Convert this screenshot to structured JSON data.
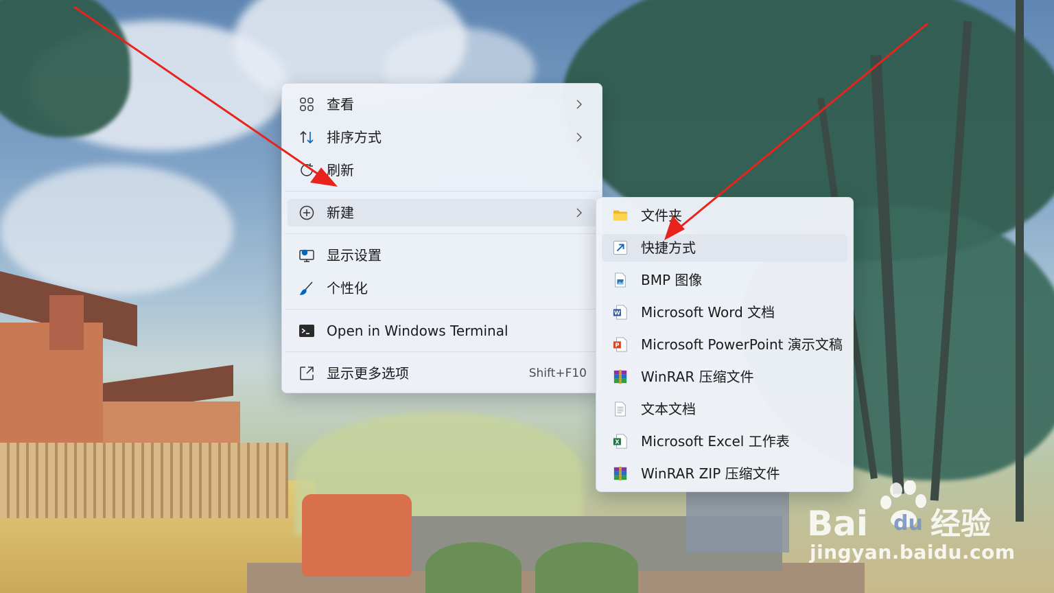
{
  "context_menu": {
    "items": [
      {
        "id": "view",
        "label": "查看",
        "icon": "grid-icon",
        "has_submenu": true
      },
      {
        "id": "sort",
        "label": "排序方式",
        "icon": "sort-icon",
        "has_submenu": true
      },
      {
        "id": "refresh",
        "label": "刷新",
        "icon": "refresh-icon",
        "has_submenu": false
      },
      {
        "id": "new",
        "label": "新建",
        "icon": "plus-circle-icon",
        "has_submenu": true,
        "highlighted": true
      },
      {
        "id": "display",
        "label": "显示设置",
        "icon": "display-settings-icon",
        "has_submenu": false
      },
      {
        "id": "personalize",
        "label": "个性化",
        "icon": "brush-icon",
        "has_submenu": false
      },
      {
        "id": "terminal",
        "label": "Open in Windows Terminal",
        "icon": "terminal-icon",
        "has_submenu": false
      },
      {
        "id": "more",
        "label": "显示更多选项",
        "icon": "more-options-icon",
        "shortcut": "Shift+F10"
      }
    ]
  },
  "submenu_new": {
    "items": [
      {
        "label": "文件夹",
        "icon": "folder-icon"
      },
      {
        "label": "快捷方式",
        "icon": "shortcut-icon",
        "highlighted": true
      },
      {
        "label": "BMP 图像",
        "icon": "bmp-image-icon"
      },
      {
        "label": "Microsoft Word 文档",
        "icon": "word-icon"
      },
      {
        "label": "Microsoft PowerPoint 演示文稿",
        "icon": "powerpoint-icon"
      },
      {
        "label": "WinRAR 压缩文件",
        "icon": "winrar-icon"
      },
      {
        "label": "文本文档",
        "icon": "text-document-icon"
      },
      {
        "label": "Microsoft Excel 工作表",
        "icon": "excel-icon"
      },
      {
        "label": "WinRAR ZIP 压缩文件",
        "icon": "winrar-zip-icon"
      }
    ]
  },
  "watermark": {
    "logo_text": "Bai",
    "logo_text_2": "du",
    "logo_cn": "经验",
    "url": "jingyan.baidu.com"
  },
  "colors": {
    "arrow": "#e8231b",
    "accent": "#0067c0",
    "menu_bg": "#eef2f8",
    "hover": "#e1e6ee"
  }
}
